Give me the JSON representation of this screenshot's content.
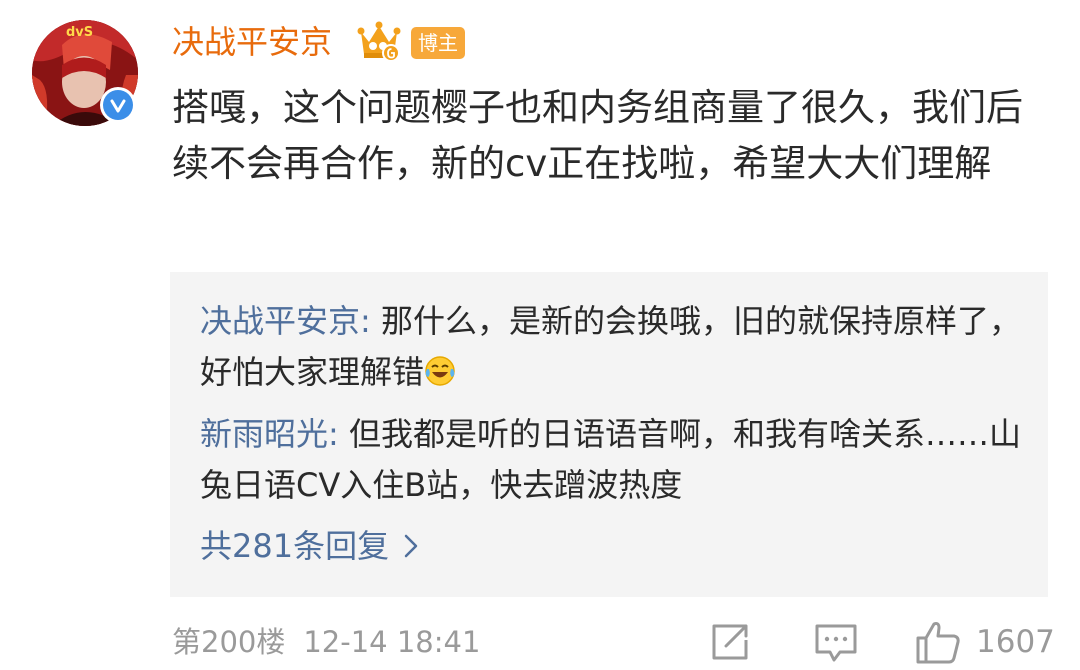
{
  "post": {
    "username": "决战平安京",
    "badge": "博主",
    "text": "搭嘎，这个问题樱子也和内务组商量了很久，我们后续不会再合作，新的cv正在找啦，希望大大们理解"
  },
  "replies": [
    {
      "user": "决战平安京",
      "separator": ":",
      "text": " 那什么，是新的会换哦，旧的就保持原样了，好怕大家理解错",
      "emoji": "laugh-cry-emoji"
    },
    {
      "user": "新雨昭光",
      "separator": ":",
      "text": " 但我都是听的日语语音啊，和我有啥关系……山兔日语CV入住B站，快去蹭波热度"
    }
  ],
  "more_replies": "共281条回复",
  "footer": {
    "floor": "第200楼",
    "date": "12-14",
    "time": "18:41",
    "like_count": "1607"
  },
  "icons": [
    "crown-icon",
    "verified-icon",
    "share-icon",
    "comment-icon",
    "like-icon",
    "chevron-right-icon"
  ],
  "colors": {
    "username": "#e86b0c",
    "badge": "#f7a83a",
    "link": "#4f6f9c",
    "verified": "#3b8ee8",
    "reply_bg": "#f4f4f4",
    "meta": "#9a9a9a"
  }
}
